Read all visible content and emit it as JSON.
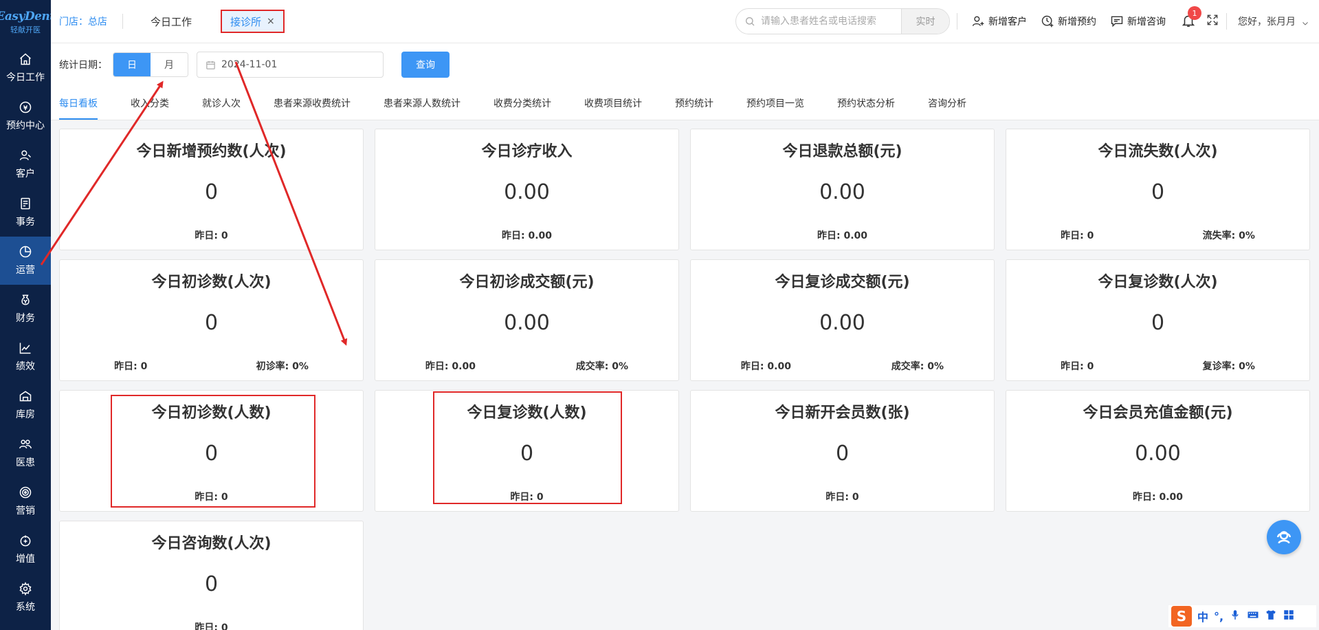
{
  "logo": {
    "brand": "EasyDent",
    "subtitle": "轻献开医"
  },
  "sidebar": {
    "items": [
      {
        "label": "今日工作",
        "icon": "home-icon"
      },
      {
        "label": "预约中心",
        "icon": "calendar-circle-icon"
      },
      {
        "label": "客户",
        "icon": "users-icon"
      },
      {
        "label": "事务",
        "icon": "clipboard-icon"
      },
      {
        "label": "运营",
        "icon": "pie-chart-icon",
        "active": true
      },
      {
        "label": "财务",
        "icon": "money-bag-icon"
      },
      {
        "label": "绩效",
        "icon": "line-chart-icon"
      },
      {
        "label": "库房",
        "icon": "warehouse-icon"
      },
      {
        "label": "医患",
        "icon": "doctor-patient-icon"
      },
      {
        "label": "营销",
        "icon": "target-icon"
      },
      {
        "label": "增值",
        "icon": "plus-circle-icon"
      },
      {
        "label": "系统",
        "icon": "gear-icon"
      }
    ]
  },
  "header": {
    "store": "门店：总店",
    "tabs": [
      {
        "label": "今日工作"
      },
      {
        "label": "接诊所",
        "active": true,
        "close": "×"
      }
    ],
    "search": {
      "placeholder": "请输入患者姓名或电话搜索",
      "button": "实时"
    },
    "actions": [
      {
        "label": "新增客户",
        "icon": "add-user-icon"
      },
      {
        "label": "新增预约",
        "icon": "add-clock-icon"
      },
      {
        "label": "新增咨询",
        "icon": "chat-icon"
      }
    ],
    "notification_count": "1",
    "greeting": "您好，张月月"
  },
  "filter": {
    "label": "统计日期：",
    "segments": [
      {
        "label": "日",
        "selected": true
      },
      {
        "label": "月",
        "selected": false
      }
    ],
    "date": "2024-11-01",
    "query_button": "查询"
  },
  "subtabs": [
    {
      "label": "每日看板",
      "active": true
    },
    {
      "label": "收入分类"
    },
    {
      "label": "就诊人次"
    },
    {
      "label": "患者来源收费统计"
    },
    {
      "label": "患者来源人数统计"
    },
    {
      "label": "收费分类统计"
    },
    {
      "label": "收费项目统计"
    },
    {
      "label": "预约统计"
    },
    {
      "label": "预约项目一览"
    },
    {
      "label": "预约状态分析"
    },
    {
      "label": "咨询分析"
    }
  ],
  "cards": [
    {
      "title": "今日新增预约数(人次)",
      "value": "0",
      "foot": [
        "昨日: 0"
      ]
    },
    {
      "title": "今日诊疗收入",
      "value": "0.00",
      "foot": [
        "昨日: 0.00"
      ]
    },
    {
      "title": "今日退款总额(元)",
      "value": "0.00",
      "foot": [
        "昨日: 0.00"
      ]
    },
    {
      "title": "今日流失数(人次)",
      "value": "0",
      "foot": [
        "昨日: 0",
        "流失率: 0%"
      ]
    },
    {
      "title": "今日初诊数(人次)",
      "value": "0",
      "foot": [
        "昨日: 0",
        "初诊率: 0%"
      ]
    },
    {
      "title": "今日初诊成交额(元)",
      "value": "0.00",
      "foot": [
        "昨日: 0.00",
        "成交率: 0%"
      ]
    },
    {
      "title": "今日复诊成交额(元)",
      "value": "0.00",
      "foot": [
        "昨日: 0.00",
        "成交率: 0%"
      ]
    },
    {
      "title": "今日复诊数(人次)",
      "value": "0",
      "foot": [
        "昨日: 0",
        "复诊率: 0%"
      ]
    },
    {
      "title": "今日初诊数(人数)",
      "value": "0",
      "foot": [
        "昨日: 0"
      ]
    },
    {
      "title": "今日复诊数(人数)",
      "value": "0",
      "foot": [
        "昨日: 0"
      ]
    },
    {
      "title": "今日新开会员数(张)",
      "value": "0",
      "foot": [
        "昨日: 0"
      ]
    },
    {
      "title": "今日会员充值金额(元)",
      "value": "0.00",
      "foot": [
        "昨日: 0.00"
      ]
    },
    {
      "title": "今日咨询数(人次)",
      "value": "0",
      "foot": [
        "昨日: 0"
      ]
    }
  ],
  "ime": {
    "logo": "S",
    "lang": "中",
    "punct": "°,"
  },
  "colors": {
    "sidebar_bg": "#0d2246",
    "sidebar_active": "#1d4f93",
    "accent": "#2d8cf0",
    "annotation_red": "#e02828"
  }
}
